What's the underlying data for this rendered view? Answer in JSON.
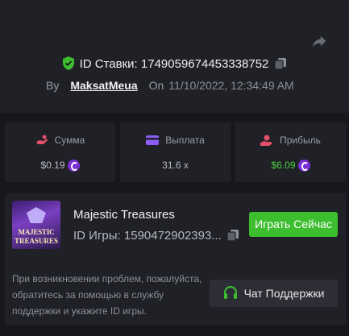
{
  "bet": {
    "id_label": "ID Ставки:",
    "id_value": "1749059674453338752",
    "by_label": "By",
    "user": "MaksatMeua",
    "on_label": "On",
    "date": "11/10/2022, 12:34:49 AM"
  },
  "stats": [
    {
      "label": "Сумма",
      "value": "$0.19",
      "icon": "coins-hand-icon",
      "color": "#e2506a"
    },
    {
      "label": "Выплата",
      "value": "31.6 x",
      "icon": "card-icon",
      "color": "#8b5cf6"
    },
    {
      "label": "Прибыль",
      "value": "$6.09",
      "icon": "hand-coin-icon",
      "color": "#e2506a",
      "value_color": "#4ccf3e"
    }
  ],
  "game": {
    "thumb_line1": "MAJESTIC",
    "thumb_line2": "TREASURES",
    "name": "Majestic Treasures",
    "id_text": "ID Игры: 1590472902393...",
    "play_label": "Играть Сейчас",
    "help_text": "При возникновении проблем, пожалуйста, обратитесь за помощью в службу поддержки и укажите ID игры.",
    "support_label": "Чат Поддержки"
  },
  "colors": {
    "accent_green": "#3dbe2f",
    "coin_purple": "#7b2fd6",
    "profit_green": "#4ccf3e"
  }
}
